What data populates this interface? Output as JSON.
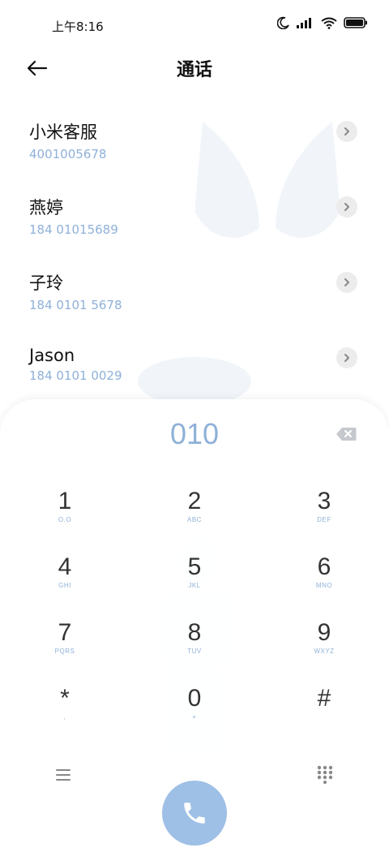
{
  "status": {
    "time": "上午8:16",
    "icons": [
      "moon-icon",
      "signal-icon",
      "wifi-icon",
      "battery-icon"
    ]
  },
  "header": {
    "title": "通话",
    "back_icon": "back-arrow-icon"
  },
  "contacts": [
    {
      "name": "小米客服",
      "number": "4001005678"
    },
    {
      "name": "燕婷",
      "number": "184 01015689"
    },
    {
      "name": "子玲",
      "number": "184 0101 5678"
    },
    {
      "name": "Jason",
      "number": "184 0101 0029"
    }
  ],
  "dialer": {
    "input": "010",
    "keys": [
      {
        "digit": "1",
        "letters": "O.O"
      },
      {
        "digit": "2",
        "letters": "ABC"
      },
      {
        "digit": "3",
        "letters": "DEF"
      },
      {
        "digit": "4",
        "letters": "GHI"
      },
      {
        "digit": "5",
        "letters": "JKL"
      },
      {
        "digit": "6",
        "letters": "MNO"
      },
      {
        "digit": "7",
        "letters": "PQRS"
      },
      {
        "digit": "8",
        "letters": "TUV"
      },
      {
        "digit": "9",
        "letters": "WXYZ"
      },
      {
        "digit": "*",
        "letters": ","
      },
      {
        "digit": "0",
        "letters": "+"
      },
      {
        "digit": "#",
        "letters": ""
      }
    ]
  },
  "colors": {
    "accent": "#8fb1d8",
    "call_button": "#9ebfe6",
    "text": "#111111"
  }
}
